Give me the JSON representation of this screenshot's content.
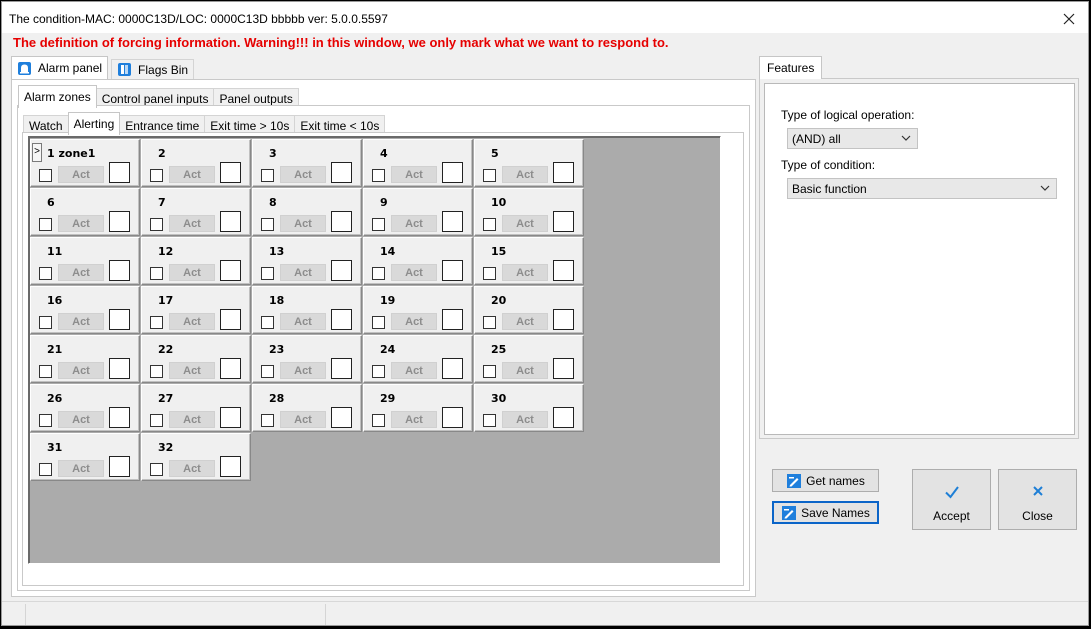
{
  "window": {
    "title": "The condition-MAC: 0000C13D/LOC: 0000C13D bbbbb ver: 5.0.0.5597",
    "warning": "The definition of forcing information. Warning!!! in this window, we only mark what we want to respond to."
  },
  "tabs_main": [
    {
      "label": "Alarm panel",
      "icon": "bell-icon",
      "active": true
    },
    {
      "label": "Flags Bin",
      "icon": "flags-icon",
      "active": false
    }
  ],
  "tabs_section": [
    {
      "label": "Alarm zones",
      "active": true
    },
    {
      "label": "Control panel inputs",
      "active": false
    },
    {
      "label": "Panel outputs",
      "active": false
    }
  ],
  "tabs_sub": [
    {
      "label": "Watch",
      "active": false
    },
    {
      "label": "Alerting",
      "active": true
    },
    {
      "label": "Entrance time",
      "active": false
    },
    {
      "label": "Exit time > 10s",
      "active": false
    },
    {
      "label": "Exit time < 10s",
      "active": false
    }
  ],
  "zones": {
    "act_label": "Act",
    "marker": ">",
    "items": [
      {
        "label": "1 zone1"
      },
      {
        "label": "2"
      },
      {
        "label": "3"
      },
      {
        "label": "4"
      },
      {
        "label": "5"
      },
      {
        "label": "6"
      },
      {
        "label": "7"
      },
      {
        "label": "8"
      },
      {
        "label": "9"
      },
      {
        "label": "10"
      },
      {
        "label": "11"
      },
      {
        "label": "12"
      },
      {
        "label": "13"
      },
      {
        "label": "14"
      },
      {
        "label": "15"
      },
      {
        "label": "16"
      },
      {
        "label": "17"
      },
      {
        "label": "18"
      },
      {
        "label": "19"
      },
      {
        "label": "20"
      },
      {
        "label": "21"
      },
      {
        "label": "22"
      },
      {
        "label": "23"
      },
      {
        "label": "24"
      },
      {
        "label": "25"
      },
      {
        "label": "26"
      },
      {
        "label": "27"
      },
      {
        "label": "28"
      },
      {
        "label": "29"
      },
      {
        "label": "30"
      },
      {
        "label": "31"
      },
      {
        "label": "32"
      }
    ]
  },
  "features": {
    "tab_label": "Features",
    "logical_op_label": "Type of logical operation:",
    "logical_op_value": "(AND) all",
    "condition_label": "Type of condition:",
    "condition_value": "Basic function"
  },
  "buttons": {
    "get_names": "Get names",
    "save_names": "Save Names",
    "accept": "Accept",
    "close": "Close"
  },
  "colors": {
    "warning": "#e60000",
    "accept_check": "#1e7fd6",
    "close_x": "#1e7fd6",
    "focus": "#0a64c8"
  }
}
